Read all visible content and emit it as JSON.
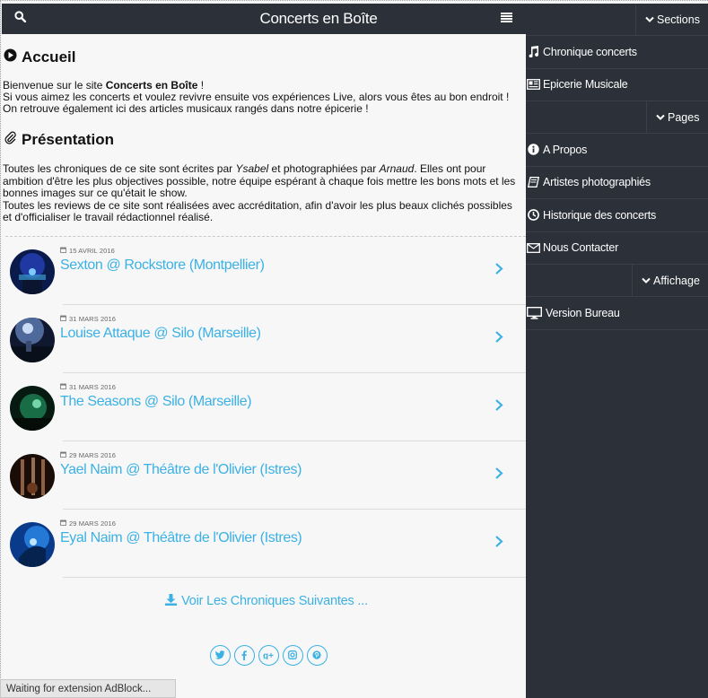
{
  "header": {
    "title": "Concerts en Boîte"
  },
  "accueil": {
    "heading": "Accueil",
    "line1_prefix": "Bienvenue sur le site ",
    "line1_bold": "Concerts en Boîte",
    "line1_suffix": " !",
    "line2": "Si vous aimez les concerts et voulez revivre ensuite vos expériences Live, alors vous êtes au bon endroit !",
    "line3": "On retrouve également ici des articles musicaux rangés dans notre épicerie !"
  },
  "presentation": {
    "heading": "Présentation",
    "p1_a": "Toutes les chroniques de ce site sont écrites par ",
    "p1_author": "Ysabel",
    "p1_b": " et photographiées par ",
    "p1_photographer": "Arnaud",
    "p1_c": ". Elles ont pour ambition d'être les plus objectives possible, notre équipe espérant à chaque fois mettre les bons mots et les bonnes images sur ce qu'était le show.",
    "p2": "Toutes les reviews de ce site sont réalisées avec accréditation, afin d'avoir les plus beaux clichés possibles et d'officialiser le travail rédactionnel réalisé."
  },
  "articles": [
    {
      "date": "15 AVRIL 2016",
      "title": "Sexton @ Rockstore (Montpellier)"
    },
    {
      "date": "31 MARS 2016",
      "title": "Louise Attaque @ Silo (Marseille)"
    },
    {
      "date": "31 MARS 2016",
      "title": "The Seasons @ Silo (Marseille)"
    },
    {
      "date": "29 MARS 2016",
      "title": "Yael Naim @ Théâtre de l'Olivier (Istres)"
    },
    {
      "date": "29 MARS 2016",
      "title": "Eyal Naim @ Théâtre de l'Olivier (Istres)"
    }
  ],
  "more_link": "Voir Les Chroniques Suivantes ...",
  "sidebar": {
    "sections_label": "Sections",
    "pages_label": "Pages",
    "affichage_label": "Affichage",
    "sections": [
      {
        "label": "Chronique concerts",
        "icon": "music-icon"
      },
      {
        "label": "Epicerie Musicale",
        "icon": "newspaper-icon"
      }
    ],
    "pages": [
      {
        "label": "A Propos",
        "icon": "info-icon"
      },
      {
        "label": "Artistes photographiés",
        "icon": "book-icon"
      },
      {
        "label": "Historique des concerts",
        "icon": "clock-icon"
      },
      {
        "label": "Nous Contacter",
        "icon": "envelope-icon"
      }
    ],
    "affichage": [
      {
        "label": "Version Bureau",
        "icon": "desktop-icon"
      }
    ]
  },
  "status": {
    "text": "Waiting for extension AdBlock..."
  },
  "colors": {
    "accent": "#3bb1e4",
    "dark": "#2c3038",
    "panel": "#f7f7f7"
  }
}
